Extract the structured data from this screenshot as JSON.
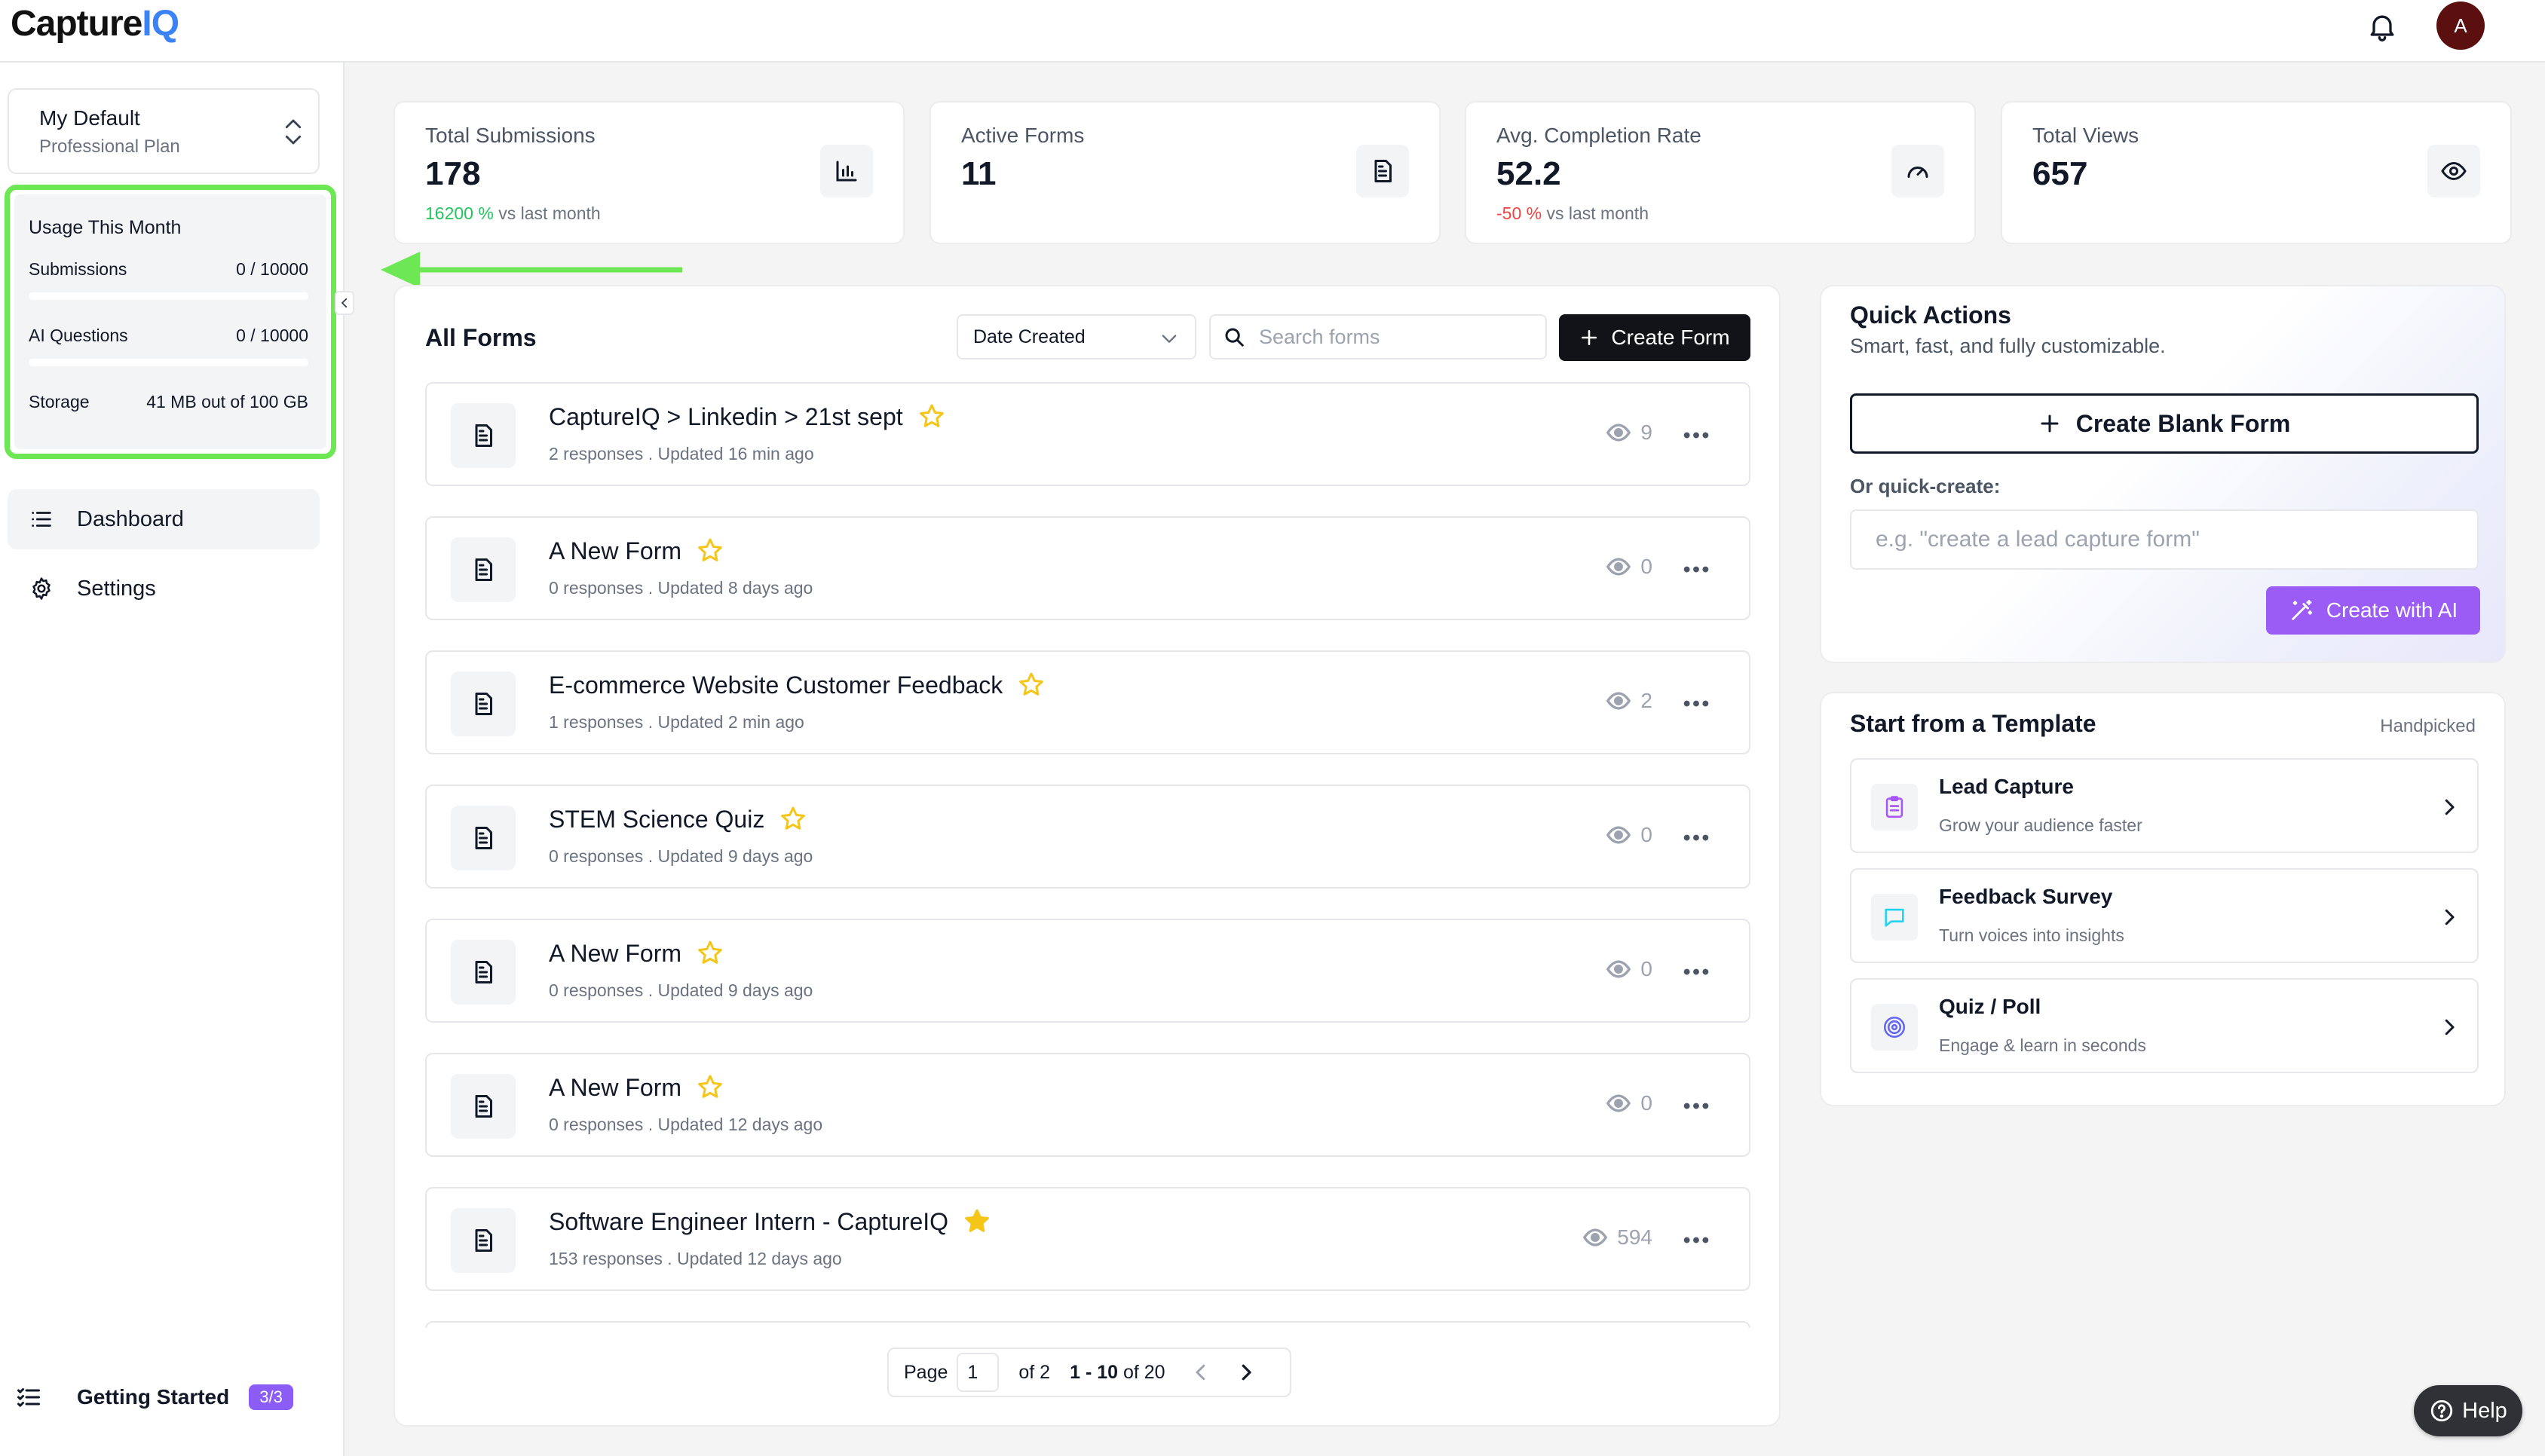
{
  "app": {
    "logo_main": "Capture",
    "logo_accent": "IQ",
    "avatar_initial": "A",
    "accent_color": "#3b82f6"
  },
  "sidebar": {
    "workspace_name": "My Default",
    "workspace_plan": "Professional Plan",
    "usage": {
      "title": "Usage This Month",
      "rows": [
        {
          "label": "Submissions",
          "value": "0 / 10000",
          "progress": 0
        },
        {
          "label": "AI Questions",
          "value": "0 / 10000",
          "progress": 0
        },
        {
          "label": "Storage",
          "value": "41 MB out of 100 GB"
        }
      ]
    },
    "nav": [
      {
        "label": "Dashboard",
        "icon": "list-icon",
        "active": true
      },
      {
        "label": "Settings",
        "icon": "gear-icon",
        "active": false
      }
    ],
    "getting_started": {
      "label": "Getting Started",
      "badge": "3/3"
    }
  },
  "stats": [
    {
      "label": "Total Submissions",
      "value": "178",
      "trend_value": "16200 %",
      "trend_text": "vs last month",
      "trend_dir": "up",
      "icon": "bar-chart-icon"
    },
    {
      "label": "Active Forms",
      "value": "11",
      "icon": "document-icon"
    },
    {
      "label": "Avg. Completion Rate",
      "value": "52.2",
      "trend_value": "-50 %",
      "trend_text": "vs last month",
      "trend_dir": "down",
      "icon": "gauge-icon"
    },
    {
      "label": "Total Views",
      "value": "657",
      "icon": "eye-icon"
    }
  ],
  "forms_panel": {
    "title": "All Forms",
    "sort_value": "Date Created",
    "search_placeholder": "Search forms",
    "create_label": "Create Form",
    "forms": [
      {
        "title": "CaptureIQ > Linkedin > 21st sept",
        "meta": "2 responses . Updated 16 min ago",
        "views": "9",
        "starred": false
      },
      {
        "title": "A New Form",
        "meta": "0 responses . Updated 8 days ago",
        "views": "0",
        "starred": false
      },
      {
        "title": "E-commerce Website Customer Feedback",
        "meta": "1 responses . Updated 2 min ago",
        "views": "2",
        "starred": false
      },
      {
        "title": "STEM Science Quiz",
        "meta": "0 responses . Updated 9 days ago",
        "views": "0",
        "starred": false
      },
      {
        "title": "A New Form",
        "meta": "0 responses . Updated 9 days ago",
        "views": "0",
        "starred": false
      },
      {
        "title": "A New Form",
        "meta": "0 responses . Updated 12 days ago",
        "views": "0",
        "starred": false
      },
      {
        "title": "Software Engineer Intern - CaptureIQ",
        "meta": "153 responses . Updated 12 days ago",
        "views": "594",
        "starred": true
      }
    ],
    "pagination": {
      "page_label": "Page",
      "page_value": "1",
      "of_label": "of 2",
      "range_bold": "1 - 10",
      "range_rest": "of 20"
    }
  },
  "quick_actions": {
    "title": "Quick Actions",
    "subtitle": "Smart, fast, and fully customizable.",
    "blank_label": "Create Blank Form",
    "quick_label": "Or quick-create:",
    "quick_placeholder": "e.g. \"create a lead capture form\"",
    "ai_label": "Create with AI"
  },
  "templates": {
    "title": "Start from a Template",
    "tag": "Handpicked",
    "items": [
      {
        "name": "Lead Capture",
        "desc": "Grow your audience faster",
        "icon": "clipboard-icon",
        "color": "#a855f7"
      },
      {
        "name": "Feedback Survey",
        "desc": "Turn voices into insights",
        "icon": "chat-bubble-icon",
        "color": "#22d3ee"
      },
      {
        "name": "Quiz / Poll",
        "desc": "Engage & learn in seconds",
        "icon": "target-icon",
        "color": "#6366f1"
      }
    ]
  },
  "help": {
    "label": "Help"
  },
  "colors": {
    "highlight_green": "#6ee754",
    "ai_purple": "#9b5cf6",
    "star_gold": "#f5c518"
  }
}
